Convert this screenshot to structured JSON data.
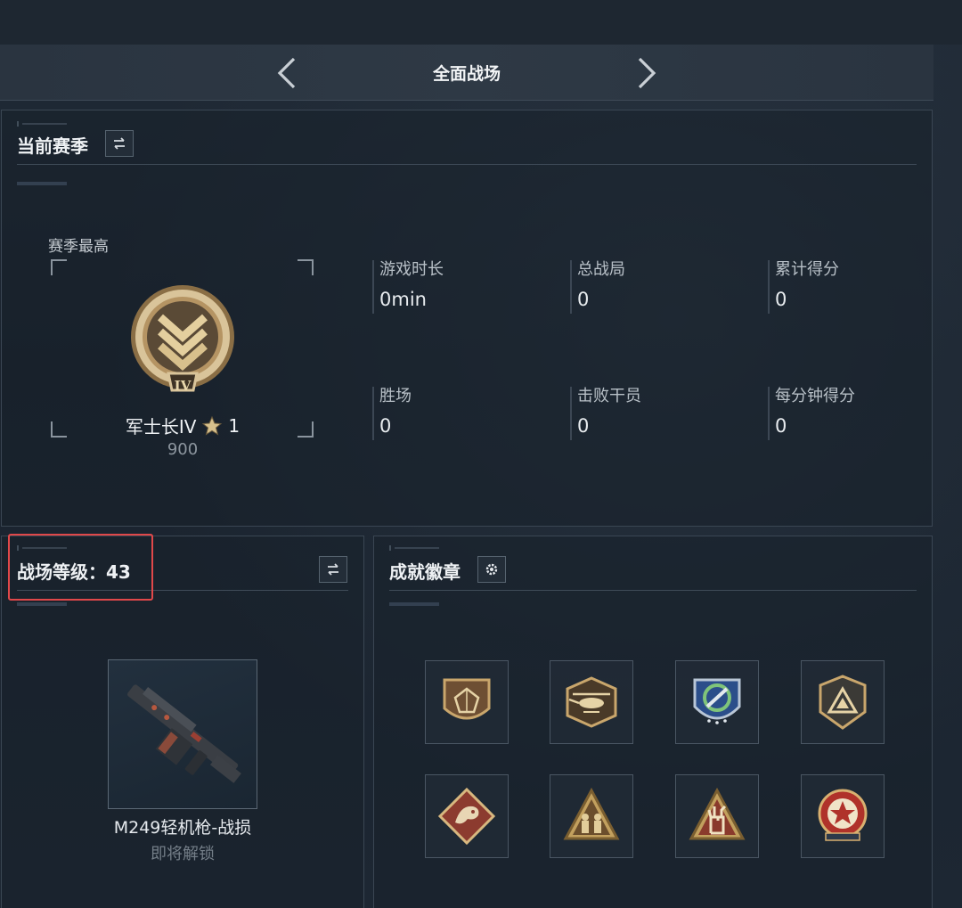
{
  "header": {
    "title": "全面战场"
  },
  "season": {
    "title": "当前赛季",
    "peak_label": "赛季最高",
    "rank_name": "军士长IV",
    "rank_stars": "1",
    "rank_score": "900",
    "rank_numeral": "IV",
    "stats": [
      {
        "label": "游戏时长",
        "value": "0min"
      },
      {
        "label": "总战局",
        "value": "0"
      },
      {
        "label": "累计得分",
        "value": "0"
      },
      {
        "label": "胜场",
        "value": "0"
      },
      {
        "label": "击败干员",
        "value": "0"
      },
      {
        "label": "每分钟得分",
        "value": "0"
      }
    ]
  },
  "level": {
    "title": "战场等级：43",
    "weapon_name": "M249轻机枪-战损",
    "weapon_status": "即将解锁"
  },
  "achievements": {
    "title": "成就徽章",
    "badges": [
      "pentagon-badge-icon",
      "helicopter-badge-icon",
      "recycle-shield-badge-icon",
      "triangle-mountain-badge-icon",
      "dragon-badge-icon",
      "soldiers-badge-icon",
      "hand-gesture-badge-icon",
      "star-target-badge-icon"
    ]
  },
  "colors": {
    "accent_gold": "#c8a266",
    "highlight_red": "#e0484a",
    "panel_border": "#3a4653"
  }
}
